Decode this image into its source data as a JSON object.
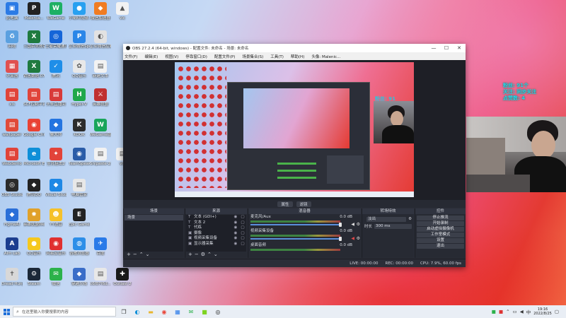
{
  "desktop": {
    "icons": [
      {
        "label": "此电脑",
        "glyph": "▣",
        "color": "#2c7be5"
      },
      {
        "label": "Malenia...",
        "glyph": "P",
        "color": "#222222"
      },
      {
        "label": "WeGame",
        "glyph": "W",
        "color": "#1db064"
      },
      {
        "label": "小喇叭视频…",
        "glyph": "●",
        "color": "#28a0f0"
      },
      {
        "label": "微信加速器",
        "glyph": "◆",
        "color": "#f07c22"
      },
      {
        "label": "vlc",
        "glyph": "▲",
        "color": "#f2f2f2"
      },
      {
        "label": "回收",
        "glyph": "♻",
        "color": "#5aa0e0"
      },
      {
        "label": "三国杀竞技版",
        "glyph": "X",
        "color": "#1f7a3f"
      },
      {
        "label": "王者荣耀通讯录",
        "glyph": "◎",
        "color": "#1565d8"
      },
      {
        "label": "企业微信Spel",
        "glyph": "P",
        "color": "#2a86e8"
      },
      {
        "label": "企业微信控制",
        "glyph": "◐",
        "color": "#e2e2e2"
      },
      {
        "label": "xls",
        "glyph": "▤",
        "color": "#f2f2f2"
      },
      {
        "label": "计算器",
        "glyph": "▦",
        "color": "#e05050"
      },
      {
        "label": "销售数据 0726.xlsx",
        "glyph": "X",
        "color": "#1f7a3f"
      },
      {
        "label": "腾讯",
        "glyph": "✓",
        "color": "#1f8ee8"
      },
      {
        "label": "QQ音乐",
        "glyph": "✿",
        "color": "#e8e8e8"
      },
      {
        "label": "新建文本",
        "glyph": "▤",
        "color": "#f2f2f2"
      },
      {
        "label": "xls",
        "glyph": "▤",
        "color": "#e0443a"
      },
      {
        "label": "SCF控制平台",
        "glyph": "▤",
        "color": "#e0443a"
      },
      {
        "label": "头条直播间",
        "glyph": "▤",
        "color": "#d83a3a"
      },
      {
        "label": "Hyper-V",
        "glyph": "H",
        "color": "#1fa84a"
      },
      {
        "label": "英雄联盟",
        "glyph": "⚔",
        "color": "#c03030"
      },
      {
        "label": "wallpaper",
        "glyph": "▤",
        "color": "#e04a3a"
      },
      {
        "label": "Google Chrome",
        "glyph": "◉",
        "color": "#e94235"
      },
      {
        "label": "鲁大师",
        "glyph": "◆",
        "color": "#2474e0"
      },
      {
        "label": "KOOK",
        "glyph": "K",
        "color": "#2c2c2c"
      },
      {
        "label": "WeGame版",
        "glyph": "W",
        "color": "#19a55a"
      },
      {
        "label": "Webdemo",
        "glyph": "▤",
        "color": "#e0443a"
      },
      {
        "label": "Microsoft Edge",
        "glyph": "e",
        "color": "#0e8fd8"
      },
      {
        "label": "生死狙击2",
        "glyph": "✦",
        "color": "#e2433a"
      },
      {
        "label": "TeamSpeak 3",
        "glyph": "◉",
        "color": "#2a5ca8"
      },
      {
        "label": "Snipaste-2...",
        "glyph": "▤",
        "color": "#f2f2f2"
      },
      {
        "label": "vlc",
        "glyph": "▤",
        "color": "#f2f2f2"
      },
      {
        "label": "OBS Studio",
        "glyph": "◎",
        "color": "#2b2b2b"
      },
      {
        "label": "腾讯QQ",
        "glyph": "◆",
        "color": "#222222"
      },
      {
        "label": "Visual Studio Code",
        "glyph": "◆",
        "color": "#1e88e5"
      },
      {
        "label": "电脑管家",
        "glyph": "▤",
        "color": "#e8e8e8"
      },
      {
        "label": "FigmaAI",
        "glyph": "◆",
        "color": "#2a6fd8"
      },
      {
        "label": "英雄联盟WeGame",
        "glyph": "✹",
        "color": "#e0a12a"
      },
      {
        "label": "YY语音",
        "glyph": "☻",
        "color": "#f5c12a"
      },
      {
        "label": "Epic Games Launcher",
        "glyph": "E",
        "color": "#222222"
      },
      {
        "label": "Alm Lab",
        "glyph": "A",
        "color": "#1b3d8f"
      },
      {
        "label": "QQ音乐",
        "glyph": "●",
        "color": "#f5c81e"
      },
      {
        "label": "网易云音乐",
        "glyph": "◉",
        "color": "#e03030"
      },
      {
        "label": "谷歌浏览器",
        "glyph": "◍",
        "color": "#2d8ee8"
      },
      {
        "label": "百度",
        "glyph": "✈",
        "color": "#2a7ae8"
      },
      {
        "label": "Dread Hunger",
        "glyph": "✝",
        "color": "#d8d8d8"
      },
      {
        "label": "Steam",
        "glyph": "⚙",
        "color": "#1b2838"
      },
      {
        "label": "微信",
        "glyph": "✉",
        "color": "#2cb24b"
      },
      {
        "label": "穿越火线",
        "glyph": "◆",
        "color": "#3a6dc8"
      },
      {
        "label": "c6f87f6d...",
        "glyph": "▤",
        "color": "#e8e8e8"
      },
      {
        "label": "Outlast 2",
        "glyph": "✚",
        "color": "#1a1a1a"
      }
    ]
  },
  "obs": {
    "title": "OBS 27.2.4 (64-bit, windows) - 配置文件: 未命名 - 场景: 未命名",
    "menu": [
      "文件(F)",
      "编辑(E)",
      "视图(V)",
      "停靠窗口(D)",
      "配置文件(P)",
      "场景集合(S)",
      "工具(T)",
      "帮助(H)",
      "头像: Malenic..."
    ],
    "preview_overlay_text": "粉丝: 91",
    "bar_buttons": [
      "属性",
      "滤镜"
    ],
    "docks": {
      "scenes": {
        "title": "场景",
        "items": [
          "场景"
        ]
      },
      "sources": {
        "title": "来源",
        "items": [
          {
            "icon": "T",
            "name": "文本 (GDI+)"
          },
          {
            "icon": "T",
            "name": "文本 2"
          },
          {
            "icon": "T",
            "name": "代练"
          },
          {
            "icon": "▣",
            "name": "摄像"
          },
          {
            "icon": "▣",
            "name": "视频采集设备"
          },
          {
            "icon": "▣",
            "name": "显示器采集"
          }
        ]
      },
      "mixer": {
        "title": "混音器",
        "channels": [
          {
            "name": "麦克风/Aux",
            "db": "0.0 dB"
          },
          {
            "name": "视频采集设备",
            "db": "0.0 dB"
          },
          {
            "name": "桌面音频",
            "db": "0.0 dB"
          }
        ]
      },
      "transitions": {
        "title": "转场特效",
        "type": "淡出",
        "duration_label": "时长",
        "duration": "300 ms"
      },
      "controls": {
        "title": "控件",
        "buttons": [
          "停止推流",
          "开始录制",
          "启动虚拟摄像机",
          "工作室模式",
          "设置",
          "退出"
        ]
      }
    },
    "status": {
      "live": "LIVE: 00:00:00",
      "rec": "REC: 00:00:00",
      "cpu": "CPU: 7.9%, 60.00 fps"
    }
  },
  "stream_overlay": {
    "lines": [
      "粉丝: 91个",
      "关注: 同步关注",
      "点赞数: 4"
    ]
  },
  "taskbar": {
    "search_placeholder": "在这里输入你要搜索的内容",
    "apps": [
      "task-view",
      "edge",
      "explorer",
      "chrome",
      "store",
      "wechat",
      "kook",
      "obs"
    ],
    "time": "19:16",
    "date": "2022/8/25"
  }
}
